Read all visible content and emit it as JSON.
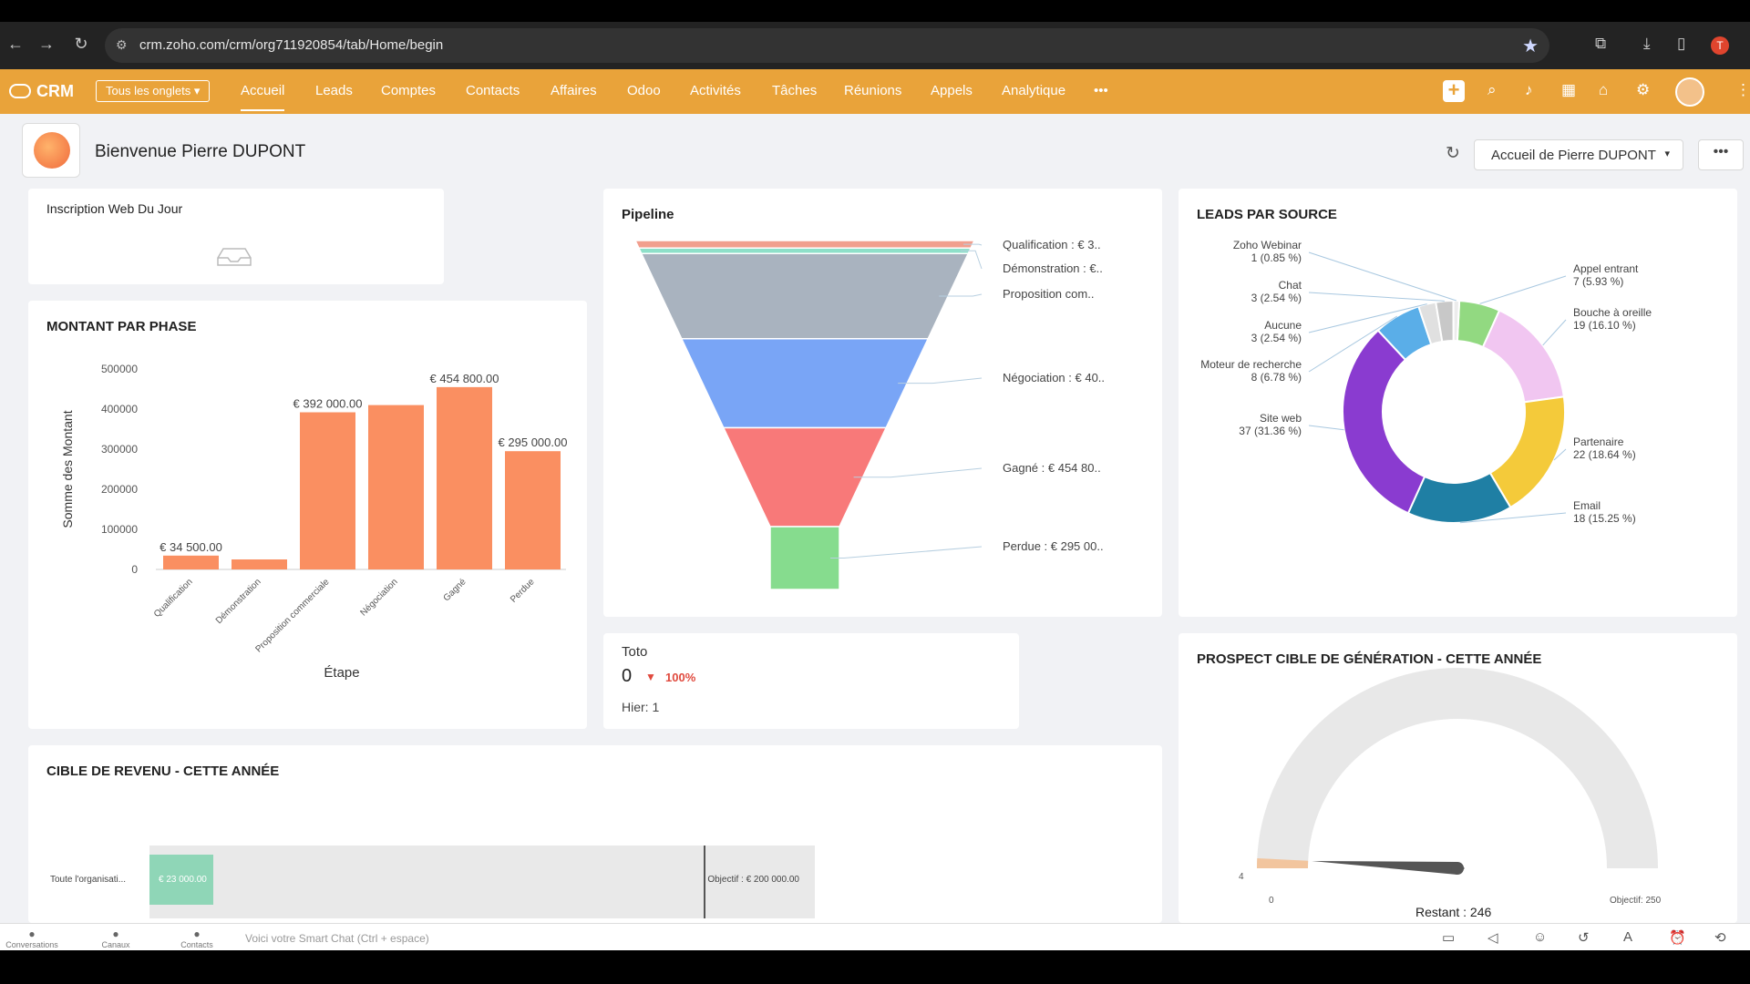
{
  "browser": {
    "url": "crm.zoho.com/crm/org711920854/tab/Home/begin",
    "profile_initial": "T"
  },
  "topbar": {
    "app_name": "CRM",
    "all_tabs": "Tous les onglets",
    "tabs": [
      "Accueil",
      "Leads",
      "Comptes",
      "Contacts",
      "Affaires",
      "Odoo",
      "Activités",
      "Tâches",
      "Réunions",
      "Appels",
      "Analytique"
    ],
    "more": "•••"
  },
  "header": {
    "welcome": "Bienvenue Pierre DUPONT",
    "home_select": "Accueil de Pierre DUPONT",
    "more": "•••"
  },
  "inscription": {
    "title": "Inscription Web Du Jour"
  },
  "montant": {
    "title": "MONTANT PAR PHASE"
  },
  "pipeline": {
    "title": "Pipeline"
  },
  "leads_source": {
    "title": "LEADS PAR SOURCE"
  },
  "toto": {
    "title": "Toto",
    "value": "0",
    "change": "100%",
    "yesterday": "Hier: 1",
    "trend_color": "#e0493d"
  },
  "prospect": {
    "title": "PROSPECT CIBLE DE GÉNÉRATION - CETTE ANNÉE",
    "remaining": "Restant : 246",
    "min": "0",
    "max": "Objectif: 250",
    "current_label": "4"
  },
  "revenu": {
    "title": "CIBLE DE REVENU - CETTE ANNÉE",
    "row_label": "Toute l'organisati...",
    "value_label": "€ 23 000.00",
    "target_label": "Objectif : € 200 000.00"
  },
  "bottom": {
    "items": [
      "Conversations",
      "Canaux",
      "Contacts"
    ],
    "smart_chat": "Voici votre Smart Chat (Ctrl + espace)"
  },
  "chart_data": [
    {
      "type": "bar",
      "title": "MONTANT PAR PHASE",
      "xlabel": "Étape",
      "ylabel": "Somme des Montant",
      "categories": [
        "Qualification",
        "Démonstration",
        "Proposition commerciale",
        "Négociation",
        "Gagné",
        "Perdue"
      ],
      "values": [
        34500,
        25000,
        392000,
        410000,
        454800,
        295000
      ],
      "data_labels": [
        "€ 34 500.00",
        "",
        "€ 392 000.00",
        "",
        "€ 454 800.00",
        "€ 295 000.00"
      ],
      "yticks": [
        "500000",
        "400000",
        "300000",
        "200000",
        "100000",
        "0"
      ],
      "ylim": [
        0,
        500000
      ],
      "color": "#fa8f61"
    },
    {
      "type": "funnel",
      "title": "Pipeline",
      "stages": [
        {
          "label": "Qualification : € 3..",
          "value": 34500,
          "color": "#f19f8e"
        },
        {
          "label": "Démonstration : €..",
          "value": 25000,
          "color": "#8ee0c9"
        },
        {
          "label": "Proposition com..",
          "value": 392000,
          "color": "#a9b3bf"
        },
        {
          "label": "Négociation : € 40..",
          "value": 410000,
          "color": "#79a5f6"
        },
        {
          "label": "Gagné : € 454 80..",
          "value": 454800,
          "color": "#f87979"
        },
        {
          "label": "Perdue : € 295 00..",
          "value": 295000,
          "color": "#86dc8e"
        }
      ]
    },
    {
      "type": "pie",
      "title": "LEADS PAR SOURCE",
      "slices": [
        {
          "name": "Appel entrant",
          "value": 7,
          "pct": "7 (5.93 %)",
          "color": "#92d981"
        },
        {
          "name": "Bouche à oreille",
          "value": 19,
          "pct": "19 (16.10 %)",
          "color": "#f1c6f1"
        },
        {
          "name": "Partenaire",
          "value": 22,
          "pct": "22 (18.64 %)",
          "color": "#f4ca3a"
        },
        {
          "name": "Email",
          "value": 18,
          "pct": "18 (15.25 %)",
          "color": "#1f7fa4"
        },
        {
          "name": "Site web",
          "value": 37,
          "pct": "37 (31.36 %)",
          "color": "#8a3bd0"
        },
        {
          "name": "Moteur de recherche",
          "value": 8,
          "pct": "8 (6.78 %)",
          "color": "#5aaee8"
        },
        {
          "name": "Aucune",
          "value": 3,
          "pct": "3 (2.54 %)",
          "color": "#e0e0e0"
        },
        {
          "name": "Chat",
          "value": 3,
          "pct": "3 (2.54 %)",
          "color": "#c8c8c8"
        },
        {
          "name": "Zoho Webinar",
          "value": 1,
          "pct": "1 (0.85 %)",
          "color": "#ececec"
        }
      ]
    },
    {
      "type": "gauge",
      "title": "PROSPECT CIBLE DE GÉNÉRATION - CETTE ANNÉE",
      "value": 4,
      "min": 0,
      "max": 250,
      "remaining": 246
    },
    {
      "type": "bar",
      "orientation": "horizontal",
      "title": "CIBLE DE REVENU - CETTE ANNÉE",
      "categories": [
        "Toute l'organisati..."
      ],
      "values": [
        23000
      ],
      "target": 200000,
      "xlim": [
        0,
        240000
      ]
    }
  ]
}
